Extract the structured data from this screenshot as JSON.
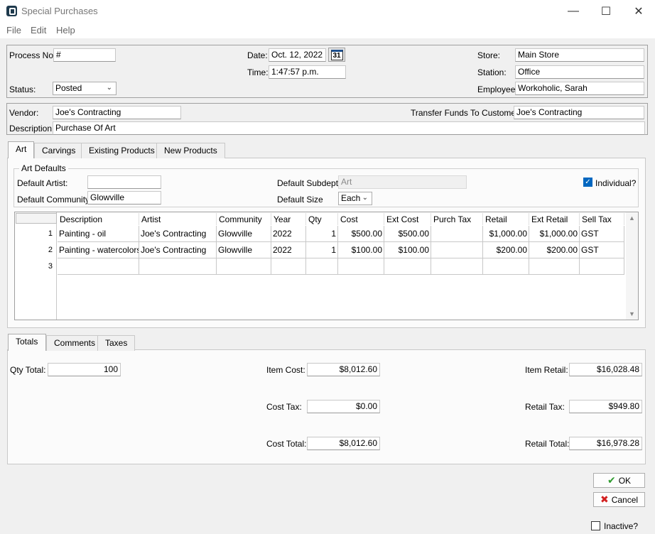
{
  "window": {
    "title": "Special Purchases",
    "min_glyph": "—",
    "max_glyph": "☐",
    "close_glyph": "✕"
  },
  "menu": [
    "File",
    "Edit",
    "Help"
  ],
  "header": {
    "process_no_label": "Process No.",
    "process_no": "#",
    "status_label": "Status:",
    "status": "Posted",
    "date_label": "Date:",
    "date": "Oct. 12, 2022",
    "calendar_glyph": "31",
    "time_label": "Time:",
    "time": "1:47:57 p.m.",
    "store_label": "Store:",
    "store": "Main Store",
    "station_label": "Station:",
    "station": "Office",
    "employee_label": "Employee:",
    "employee": "Workoholic, Sarah"
  },
  "vendor": {
    "vendor_label": "Vendor:",
    "vendor": "Joe's Contracting",
    "transfer_label": "Transfer Funds To Customer:",
    "transfer": "Joe's Contracting",
    "description_label": "Description:",
    "description": "Purchase Of Art"
  },
  "tabs": [
    "Art",
    "Carvings",
    "Existing Products",
    "New Products"
  ],
  "art_defaults": {
    "group_label": "Art Defaults",
    "artist_label": "Default Artist:",
    "artist": "",
    "community_label": "Default Community:",
    "community": "Glowville",
    "subdept_label": "Default Subdept:",
    "subdept": "Art",
    "size_label": "Default Size",
    "size": "Each",
    "individual_label": "Individual?",
    "individual_checked": true
  },
  "grid": {
    "columns": [
      "Description",
      "Artist",
      "Community",
      "Year",
      "Qty",
      "Cost",
      "Ext Cost",
      "Purch Tax",
      "Retail",
      "Ext Retail",
      "Sell Tax"
    ],
    "rows": [
      {
        "num": "1",
        "cells": [
          "Painting - oil",
          "Joe's Contracting",
          "Glowville",
          "2022",
          "1",
          "$500.00",
          "$500.00",
          "",
          "$1,000.00",
          "$1,000.00",
          "GST"
        ]
      },
      {
        "num": "2",
        "cells": [
          "Painting - watercolors",
          "Joe's Contracting",
          "Glowville",
          "2022",
          "1",
          "$100.00",
          "$100.00",
          "",
          "$200.00",
          "$200.00",
          "GST"
        ]
      },
      {
        "num": "3",
        "cells": [
          "",
          "",
          "",
          "",
          "",
          "",
          "",
          "",
          "",
          "",
          ""
        ]
      }
    ]
  },
  "bottom_tabs": [
    "Totals",
    "Comments",
    "Taxes"
  ],
  "totals": {
    "qty_label": "Qty Total:",
    "qty": "100",
    "item_cost_label": "Item Cost:",
    "item_cost": "$8,012.60",
    "cost_tax_label": "Cost Tax:",
    "cost_tax": "$0.00",
    "cost_total_label": "Cost Total:",
    "cost_total": "$8,012.60",
    "item_retail_label": "Item Retail:",
    "item_retail": "$16,028.48",
    "retail_tax_label": "Retail Tax:",
    "retail_tax": "$949.80",
    "retail_total_label": "Retail Total:",
    "retail_total": "$16,978.28"
  },
  "buttons": {
    "ok": "OK",
    "cancel": "Cancel",
    "inactive": "Inactive?"
  }
}
